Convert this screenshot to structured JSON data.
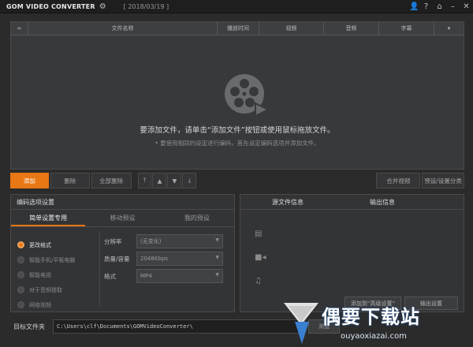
{
  "titlebar": {
    "app_name": "GOM VIDEO CONVERTER",
    "version": "[ 2018/03/19 ]",
    "icons": [
      "gear-icon",
      "user-icon",
      "help-icon",
      "home-icon",
      "minimize-icon",
      "close-icon"
    ]
  },
  "filelist": {
    "columns": [
      "文件名称",
      "播放时间",
      "视频",
      "音频",
      "字幕"
    ],
    "empty_hint": "要添加文件，请单击“添加文件”按钮或使用鼠标拖放文件。",
    "empty_subhint": "要使用相同的设定进行编码，首先设定编码选项并添加文件。"
  },
  "toolbar": {
    "add": "添加",
    "delete": "删除",
    "delete_all": "全部删除",
    "merge": "合并视频",
    "preset": "预设/设置分类",
    "move_icons": [
      "move-top-icon",
      "move-up-icon",
      "move-down-icon",
      "move-bottom-icon"
    ]
  },
  "encoding": {
    "title": "编码选项设置",
    "tabs": [
      "简单设置专用",
      "移动预设",
      "我的预设"
    ],
    "active_tab": 0,
    "radios": [
      "更改格式",
      "智能手机/平板电脑",
      "智能电视",
      "对于音频提取",
      "网络视频"
    ],
    "selected_radio": 0,
    "fields": [
      {
        "label": "分辨率",
        "value": "(无变化)"
      },
      {
        "label": "质量/容量",
        "value": "2048Kbps"
      },
      {
        "label": "格式",
        "value": "MP4"
      }
    ]
  },
  "info": {
    "source_title": "源文件信息",
    "output_title": "输出信息",
    "more_settings": "添加到“高级设置”",
    "output_settings": "输出设置"
  },
  "destination": {
    "label": "目标文件夹",
    "path": "C:\\Users\\clf\\Documents\\GOMVideoConverter\\",
    "browse": "浏览"
  },
  "watermark": {
    "text": "偶要下载站",
    "url": "ouyaoxiazai.com"
  },
  "colors": {
    "accent": "#e87714",
    "background": "#2b2b2b",
    "panel": "#333436"
  }
}
